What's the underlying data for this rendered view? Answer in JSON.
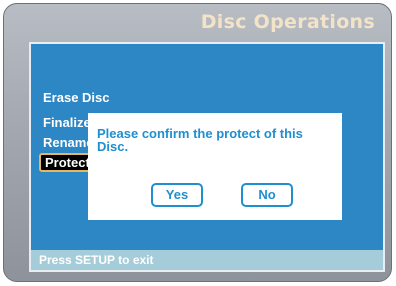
{
  "window": {
    "title": "Disc Operations"
  },
  "menu": {
    "items": [
      {
        "label": "Erase Disc"
      },
      {
        "label": "Finalize"
      },
      {
        "label": "Rename"
      },
      {
        "label": "Protect"
      }
    ],
    "selected_index": 3
  },
  "dialog": {
    "message": "Please confirm the protect of this Disc.",
    "yes_label": "Yes",
    "no_label": "No"
  },
  "status_bar": {
    "text": "Press SETUP to exit"
  },
  "colors": {
    "screen_background": "#2d87c5",
    "title_text": "#f3e3c8",
    "dialog_accent": "#1f8fd0",
    "selection_border": "#e6b65c",
    "status_bar": "#a4ccd9"
  }
}
